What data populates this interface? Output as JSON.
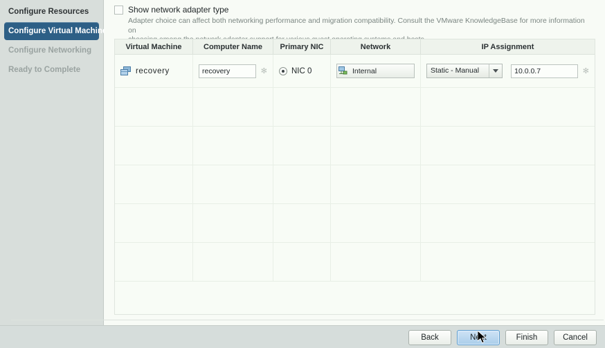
{
  "sidebar": {
    "items": [
      {
        "label": "Configure Resources",
        "state": "done"
      },
      {
        "label": "Configure Virtual Machines",
        "state": "active"
      },
      {
        "label": "Configure Networking",
        "state": "pending"
      },
      {
        "label": "Ready to Complete",
        "state": "pending"
      }
    ]
  },
  "options": {
    "show_adapter_label": "Show network adapter type",
    "show_adapter_checked": false,
    "description_line1": "Adapter choice can affect both networking performance and migration compatibility. Consult the VMware KnowledgeBase for more information on",
    "description_line2": "choosing among the network adapter support for various guest operating systems and hosts."
  },
  "table": {
    "columns": [
      "Virtual Machine",
      "Computer Name",
      "Primary NIC",
      "Network",
      "IP Assignment"
    ],
    "rows": [
      {
        "vm_name": "recovery",
        "vm_icon": "virtual-machine-icon",
        "computer_name": "recovery",
        "computer_name_required": "✻",
        "primary_nic": "NIC 0",
        "primary_nic_selected": true,
        "network": "Internal",
        "network_icon": "network-adapter-icon",
        "ip_assignment_mode": "Static - Manual",
        "ip_address": "10.0.0.7",
        "ip_required": "✻"
      }
    ],
    "empty_row_count": 5
  },
  "footer": {
    "buttons": [
      {
        "label": "Back",
        "focused": false
      },
      {
        "label": "Next",
        "focused": true
      },
      {
        "label": "Finish",
        "focused": false
      },
      {
        "label": "Cancel",
        "focused": false
      }
    ]
  },
  "colors": {
    "accent": "#2d5f86",
    "panel_bg": "#f8fbf6",
    "sidebar_bg": "#d8dedb",
    "footer_bg": "#d6dddb",
    "focus_blue": "#5b9bd0"
  }
}
